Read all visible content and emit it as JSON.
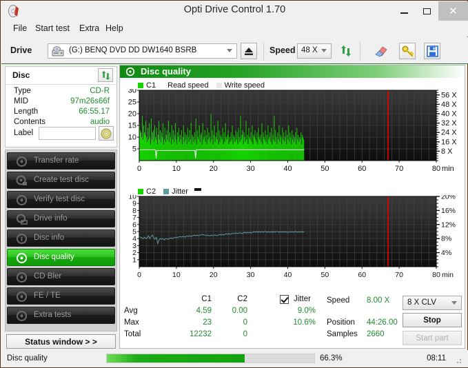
{
  "window": {
    "title": "Opti Drive Control 1.70",
    "app_icon": "disc-icon",
    "minimize": "–",
    "maximize": "❐",
    "close": "✕"
  },
  "menu": {
    "items": [
      "File",
      "Start test",
      "Extra",
      "Help"
    ]
  },
  "toolbar": {
    "drive_label": "Drive",
    "drive_value": "(G:)   BENQ DVD DD DW1640 BSRB",
    "eject_icon": "eject-icon",
    "speed_label": "Speed",
    "speed_value": "48 X",
    "refresh_icon": "refresh-arrows-icon",
    "icons": [
      "eraser-icon",
      "key-icon",
      "save-floppy-icon"
    ]
  },
  "disc_panel": {
    "title": "Disc",
    "refresh_icon": "refresh-arrows-icon",
    "rows": [
      {
        "key": "Type",
        "value": "CD-R"
      },
      {
        "key": "MID",
        "value": "97m26s66f"
      },
      {
        "key": "Length",
        "value": "66:55.17"
      },
      {
        "key": "Contents",
        "value": "audio"
      }
    ],
    "label_key": "Label",
    "label_value": "",
    "label_placeholder": "",
    "cd_icon": "cd-disc-icon"
  },
  "nav": {
    "items": [
      {
        "label": "Transfer rate",
        "icon": "disc-icon",
        "active": false
      },
      {
        "label": "Create test disc",
        "icon": "disc-write-icon",
        "active": false
      },
      {
        "label": "Verify test disc",
        "icon": "disc-icon",
        "active": false
      },
      {
        "label": "Drive info",
        "icon": "drive-icon",
        "active": false
      },
      {
        "label": "Disc info",
        "icon": "disc-info-icon",
        "active": false
      },
      {
        "label": "Disc quality",
        "icon": "disc-quality-icon",
        "active": true
      },
      {
        "label": "CD Bler",
        "icon": "disc-icon",
        "active": false
      },
      {
        "label": "FE / TE",
        "icon": "disc-icon",
        "active": false
      },
      {
        "label": "Extra tests",
        "icon": "disc-icon",
        "active": false
      }
    ],
    "status_window": "Status window > >"
  },
  "panel": {
    "title": "Disc quality",
    "icon": "disc-quality-icon"
  },
  "stats": {
    "col_c1": "C1",
    "col_c2": "C2",
    "jitter_label": "Jitter",
    "jitter_checked": true,
    "rows": [
      {
        "name": "Avg",
        "c1": "4.59",
        "c2": "0.00",
        "jitter": "9.0%"
      },
      {
        "name": "Max",
        "c1": "23",
        "c2": "0",
        "jitter": "10.6%"
      },
      {
        "name": "Total",
        "c1": "12232",
        "c2": "0",
        "jitter": ""
      }
    ],
    "speed_label": "Speed",
    "speed_value": "8.00 X",
    "position_label": "Position",
    "position_value": "44:26.00",
    "samples_label": "Samples",
    "samples_value": "2660",
    "clv_value": "8 X CLV",
    "stop_button": "Stop",
    "start_part_button": "Start part"
  },
  "statusbar": {
    "text": "Disc quality",
    "percent": "66.3%",
    "percent_value": 66.3,
    "time": "08:11"
  },
  "colors": {
    "c1_green": "#16d300",
    "jitter_teal": "#5e9c9c",
    "read_speed_white": "#ffffff",
    "cursor_red": "#ee0000",
    "accent_green": "#1e8c2e",
    "plot_bg": "#131313"
  },
  "chart_data": [
    {
      "type": "area",
      "name": "c1-chart",
      "title": "",
      "xlabel": "min",
      "ylabel": "",
      "xlim": [
        0,
        80
      ],
      "ylim": [
        0,
        30
      ],
      "xticks": [
        0,
        10,
        20,
        30,
        40,
        50,
        60,
        70,
        80
      ],
      "yticks": [
        5,
        10,
        15,
        20,
        25,
        30
      ],
      "y2ticks": [
        8,
        16,
        24,
        32,
        40,
        48,
        56
      ],
      "y2labels": [
        "8 X",
        "16 X",
        "24 X",
        "32 X",
        "40 X",
        "48 X",
        "56 X"
      ],
      "y2lim": [
        0,
        60
      ],
      "grid": true,
      "legend": [
        {
          "label": "C1",
          "color": "#16d300"
        },
        {
          "label": "Read speed",
          "color": "#ffffff"
        },
        {
          "label": "Write speed",
          "color": "#e8e8e8"
        }
      ],
      "cursor_x": 67.0,
      "data_end_x": 44.4,
      "series": [
        {
          "name": "C1",
          "color": "#16d300",
          "kind": "bars",
          "values": [
            16,
            13,
            12,
            10,
            19,
            9,
            15,
            12,
            11,
            17,
            10,
            8,
            14,
            9,
            16,
            10,
            7,
            18,
            9,
            12,
            13,
            8,
            15,
            10,
            9,
            14,
            7,
            11,
            17,
            9,
            13,
            8,
            12,
            10,
            16,
            7,
            9,
            14,
            8,
            11,
            13,
            9,
            17,
            8,
            12,
            10,
            7,
            15,
            9,
            13,
            8,
            11,
            16,
            9,
            7,
            12,
            10,
            14,
            8,
            11,
            9,
            13,
            7,
            10,
            15,
            8,
            12,
            9,
            11,
            7,
            14,
            10,
            8,
            13,
            9,
            16,
            7,
            11,
            10,
            8,
            12,
            9,
            18,
            7,
            13,
            10,
            9,
            15,
            8,
            11,
            12,
            7,
            16,
            9,
            10,
            13,
            8,
            11,
            7,
            14,
            9,
            12,
            10,
            8,
            20,
            9,
            13,
            7,
            11,
            15,
            8,
            10,
            12,
            9,
            17,
            7,
            13,
            8,
            11,
            10,
            9,
            14,
            7,
            12,
            8,
            16,
            10,
            9,
            11,
            13,
            7,
            10,
            8,
            12,
            9,
            15,
            7,
            11,
            10,
            8,
            13,
            9,
            12,
            7,
            14,
            10,
            8,
            19,
            9,
            11,
            13,
            7,
            12,
            10,
            8,
            17,
            9,
            11,
            7,
            14,
            10,
            9,
            12,
            8,
            15,
            7,
            11,
            10,
            13,
            9,
            8,
            12,
            7,
            14,
            10,
            9,
            11,
            8,
            16,
            7,
            12,
            10,
            9,
            13,
            8,
            11,
            7,
            15,
            9,
            10,
            12,
            8,
            14,
            7,
            11,
            9,
            19,
            8,
            13,
            10,
            7,
            12,
            9,
            15,
            8,
            11,
            10,
            7,
            14,
            9,
            12,
            8,
            10,
            13,
            7,
            11,
            9,
            15,
            8,
            12,
            10,
            7,
            13,
            9,
            11,
            8,
            10,
            12,
            7,
            14,
            9,
            11,
            8,
            10,
            9,
            12,
            7,
            11,
            10,
            9
          ]
        },
        {
          "name": "Read speed",
          "color": "#ffffff",
          "kind": "line",
          "note": "flat near 4.6 with two short dips",
          "values": [
            4.6,
            4.6,
            4.6,
            4.6,
            4.6,
            4.6,
            4.6,
            4.6,
            4.6,
            4.6,
            4.6,
            4.6,
            4.6,
            4.6,
            4.6,
            4.6,
            4.6,
            4.6,
            4.6,
            4.6,
            4.6,
            4.6,
            4.6,
            4.6,
            1.0,
            4.3,
            4.3,
            4.3,
            4.3,
            4.3,
            4.3,
            4.3,
            4.3,
            4.3,
            4.3,
            4.3,
            4.3,
            4.3,
            4.3,
            4.3,
            4.3,
            4.3,
            4.3,
            4.3,
            4.3,
            4.3,
            4.3,
            4.3,
            4.3,
            4.3,
            4.3,
            4.3,
            4.3,
            4.3,
            4.3,
            4.3,
            4.3,
            4.3,
            4.3,
            4.3,
            4.3,
            4.3,
            4.3,
            4.3,
            4.3,
            4.3,
            4.3,
            4.3,
            4.3,
            4.3,
            4.3,
            4.3,
            4.3,
            4.3,
            4.3,
            4.3,
            4.3,
            4.3,
            4.3,
            4.3,
            1.0,
            4.6,
            4.6,
            4.6,
            4.6,
            4.6,
            4.6,
            4.6,
            4.6,
            4.6,
            4.6,
            4.6,
            4.6,
            4.6,
            4.6,
            4.6,
            4.6,
            4.6,
            4.6,
            4.6,
            4.6,
            4.6,
            4.6,
            4.6,
            4.6,
            4.6,
            4.6,
            4.6,
            4.6,
            4.6,
            4.6,
            4.6,
            4.6,
            4.6,
            4.6,
            4.6,
            4.6,
            4.6,
            4.6,
            4.6,
            4.6,
            4.6,
            4.6,
            4.6,
            4.6,
            4.6,
            4.6,
            4.6,
            4.6,
            4.6,
            4.6,
            4.6,
            4.6,
            4.6,
            4.6,
            4.6,
            4.6,
            4.6,
            4.6,
            4.6,
            4.6,
            4.6,
            4.6,
            4.6,
            4.6,
            4.6,
            4.6,
            4.6,
            4.6,
            4.6,
            4.6,
            4.6,
            4.6,
            4.6,
            4.6,
            4.6,
            4.6,
            4.6,
            4.6,
            4.6,
            4.6,
            4.6,
            4.6,
            4.6,
            4.6,
            4.6,
            4.6,
            4.6,
            4.6,
            4.6,
            4.6,
            4.6,
            4.6,
            4.6,
            4.6,
            4.6,
            4.6,
            4.6,
            4.6,
            4.6,
            4.6,
            4.6,
            4.6,
            4.6,
            4.6,
            4.6,
            4.6,
            4.6,
            4.6,
            4.6,
            4.6,
            4.6,
            4.6,
            4.6,
            4.6,
            4.6,
            4.6,
            4.6,
            4.6,
            4.6,
            4.6,
            4.6,
            4.6,
            4.6,
            4.6,
            4.6,
            4.6,
            4.6,
            4.6,
            4.6,
            4.6,
            4.6,
            4.6,
            4.6,
            4.6,
            4.6,
            4.6,
            4.6,
            4.6,
            4.6,
            4.6,
            4.6,
            4.6,
            4.6,
            4.6,
            4.6,
            4.6,
            4.6,
            4.6,
            4.6,
            4.6,
            4.6,
            4.6,
            4.6,
            4.6
          ]
        }
      ]
    },
    {
      "type": "line",
      "name": "c2-jitter-chart",
      "title": "",
      "xlabel": "min",
      "ylabel": "",
      "xlim": [
        0,
        80
      ],
      "ylim": [
        0,
        10
      ],
      "xticks": [
        0,
        10,
        20,
        30,
        40,
        50,
        60,
        70,
        80
      ],
      "yticks": [
        1,
        2,
        3,
        4,
        5,
        6,
        7,
        8,
        9,
        10
      ],
      "y2ticks": [
        4,
        8,
        12,
        16,
        20
      ],
      "y2labels": [
        "4%",
        "8%",
        "12%",
        "16%",
        "20%"
      ],
      "y2lim": [
        0,
        20
      ],
      "grid": true,
      "legend": [
        {
          "label": "C2",
          "color": "#16d300"
        },
        {
          "label": "Jitter",
          "color": "#5e9c9c"
        }
      ],
      "cursor_x": 67.0,
      "data_end_x": 44.4,
      "series": [
        {
          "name": "Jitter",
          "color": "#5e9c9c",
          "kind": "line",
          "values": [
            4.3,
            4.2,
            4.1,
            4.0,
            4.2,
            4.0,
            4.1,
            4.4,
            4.0,
            4.3,
            4.5,
            4.1,
            3.9,
            4.2,
            3.3,
            3.8,
            4.0,
            3.9,
            4.0,
            3.8,
            4.0,
            4.0,
            3.9,
            4.0,
            4.1,
            4.0,
            4.1,
            4.2,
            4.1,
            4.2,
            4.2,
            4.3,
            4.2,
            4.3,
            4.3,
            4.2,
            4.4,
            4.3,
            4.4,
            4.3,
            4.4,
            4.4,
            4.5,
            4.4,
            4.5,
            4.4,
            4.5,
            4.5,
            4.6,
            4.5,
            4.5,
            4.4,
            4.5,
            4.4,
            4.4,
            4.5,
            4.4,
            4.5,
            4.5,
            4.4,
            4.5,
            4.6,
            4.5,
            4.6,
            4.5,
            4.6,
            4.7,
            4.6,
            4.7,
            4.6,
            4.7,
            4.7,
            4.8,
            4.7,
            4.8,
            4.7,
            4.8,
            4.8,
            4.7,
            4.8,
            4.9,
            4.8,
            4.9,
            4.8,
            4.9,
            4.8,
            4.9,
            5.0,
            4.9,
            5.0,
            4.9,
            5.0,
            4.9,
            5.0,
            4.9,
            5.0,
            5.0,
            4.9,
            5.0,
            4.9,
            5.0,
            4.9,
            5.0,
            4.9,
            5.0,
            5.0,
            4.9,
            5.0,
            4.9,
            5.0,
            4.9,
            5.0,
            4.9,
            4.9,
            5.0,
            4.9,
            5.0,
            4.9,
            5.0,
            5.0,
            4.9,
            5.0,
            4.9,
            5.0,
            4.9,
            5.0
          ]
        },
        {
          "name": "C2",
          "color": "#16d300",
          "kind": "bars",
          "values": []
        }
      ]
    }
  ]
}
